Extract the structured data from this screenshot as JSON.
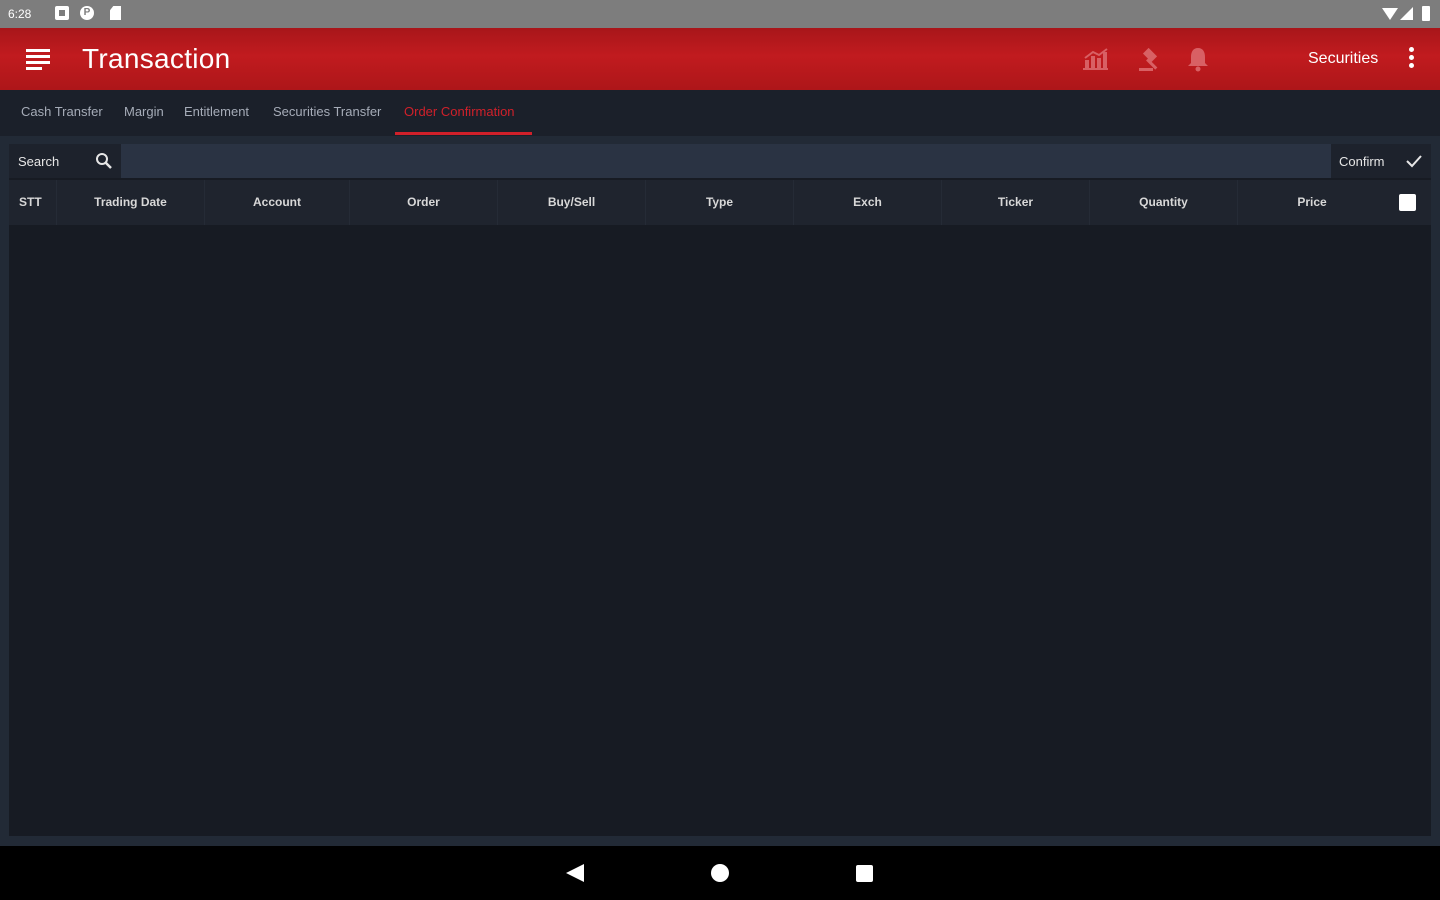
{
  "status_bar": {
    "time": "6:28",
    "p_icon": "P"
  },
  "app_bar": {
    "title": "Transaction",
    "right_label": "Securities",
    "icons": [
      "menu-icon",
      "chart-icon",
      "gavel-icon",
      "bell-icon",
      "more-vert-icon"
    ],
    "background_color": "#c11b1f"
  },
  "tabs": [
    {
      "label": "Cash Transfer",
      "active": false
    },
    {
      "label": "Margin",
      "active": false
    },
    {
      "label": "Entitlement",
      "active": false
    },
    {
      "label": "Securities Transfer",
      "active": false
    },
    {
      "label": "Order Confirmation",
      "active": true
    }
  ],
  "accent_color": "#d0202a",
  "toolbar": {
    "search_label": "Search",
    "confirm_label": "Confirm"
  },
  "table": {
    "columns": [
      "STT",
      "Trading Date",
      "Account",
      "Order",
      "Buy/Sell",
      "Type",
      "Exch",
      "Ticker",
      "Quantity",
      "Price"
    ],
    "rows": []
  }
}
